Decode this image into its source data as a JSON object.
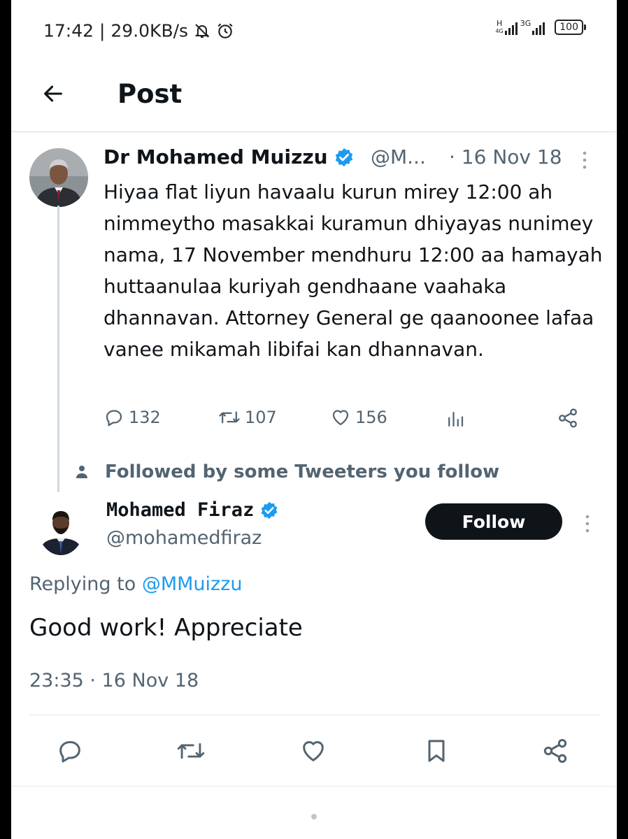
{
  "status_bar": {
    "time": "17:42",
    "separator": "|",
    "speed": "29.0KB/s",
    "network1": "H",
    "network1_sub": "4G",
    "network2": "3G",
    "battery": "100"
  },
  "header": {
    "title": "Post"
  },
  "parent_tweet": {
    "name": "Dr Mohamed Muizzu",
    "handle": "@M...",
    "date": "· 16 Nov 18",
    "text": "Hiyaa flat liyun havaalu kurun mirey 12:00 ah nimmeytho masakkai kuramun dhiyayas nunimey nama, 17 November mendhuru 12:00 aa hamayah huttaanulaa kuriyah gendhaane vaahaka dhannavan. Attorney General ge qaanoonee lafaa vanee mikamah libifai kan dhannavan.",
    "replies": "132",
    "retweets": "107",
    "likes": "156"
  },
  "followed_notice": "Followed by some Tweeters you follow",
  "reply_tweet": {
    "name": "Mohamed Firaz",
    "handle": "@mohamedfiraz",
    "follow_label": "Follow",
    "replying_prefix": "Replying to ",
    "replying_to": "@MMuizzu",
    "text": "Good work! Appreciate",
    "timestamp": "23:35 · 16 Nov 18"
  },
  "colors": {
    "accent": "#1d9bf0",
    "text": "#0f1419",
    "muted": "#536471",
    "verified": "#1d9bf0"
  },
  "icons": [
    "back-arrow-icon",
    "verified-badge-icon",
    "more-vertical-icon",
    "reply-icon",
    "retweet-icon",
    "like-icon",
    "views-icon",
    "share-icon",
    "person-icon",
    "bookmark-icon",
    "mute-bell-icon",
    "alarm-icon"
  ]
}
